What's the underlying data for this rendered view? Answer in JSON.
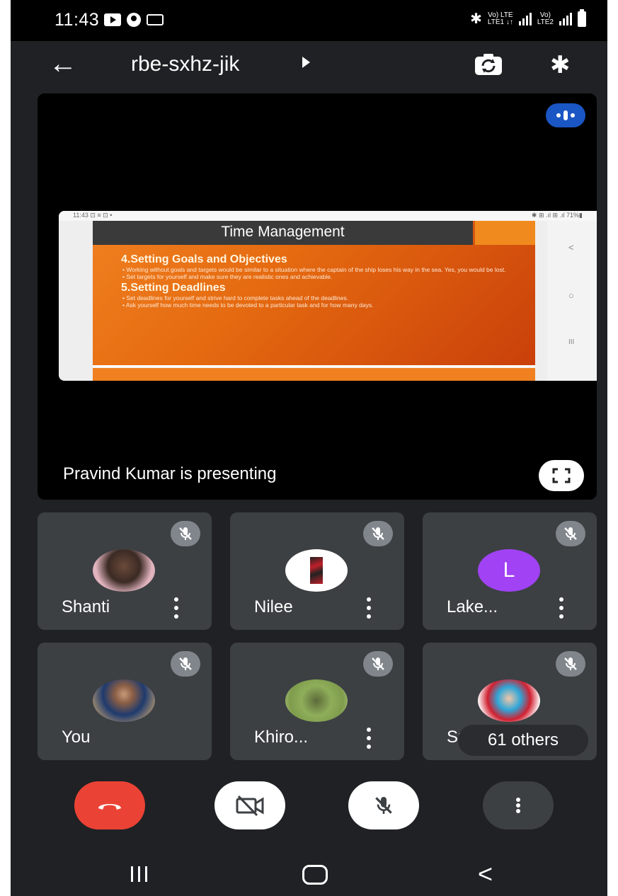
{
  "status_bar": {
    "time": "11:43",
    "network_label_1": "Vo) LTE",
    "network_sub_1": "LTE1 ↓↑",
    "network_label_2": "Vo)",
    "network_sub_2": "LTE2"
  },
  "header": {
    "meeting_code": "rbe-sxhz-jik"
  },
  "presentation": {
    "presenter_text": "Pravind Kumar is presenting",
    "slide": {
      "status_left": "11:43 ⊡ ≡ ⊡ •",
      "status_right": "✱ ⊞ .ıl ⊞ .ıl 71%▮",
      "title": "Time Management",
      "heading_1": "4.Setting Goals and Objectives",
      "bullet_1": "Working without goals and targets would be similar to a situation where the captain of the ship loses his way in the sea. Yes, you would be lost.",
      "bullet_2": "Set targets for yourself and make sure they are realistic ones and achievable.",
      "heading_2": "5.Setting Deadlines",
      "bullet_3": "Set deadlines for yourself and strive hard to complete tasks ahead of the deadlines.",
      "bullet_4": "Ask yourself how much time needs to be devoted to a particular task and for how many days.",
      "nav_back": "<",
      "nav_home": "○",
      "nav_recent": "III"
    }
  },
  "participants": [
    {
      "name": "Shanti",
      "avatar": "photo"
    },
    {
      "name": "Nilee",
      "avatar": "photo"
    },
    {
      "name": "Lake...",
      "avatar": "letter",
      "initial": "L"
    },
    {
      "name": "You",
      "avatar": "photo"
    },
    {
      "name": "Khiro...",
      "avatar": "photo"
    },
    {
      "name": "Su",
      "avatar": "photo"
    }
  ],
  "others_chip": "61 others",
  "colors": {
    "background": "#202124",
    "tile": "#3c4043",
    "end_call": "#ea4335",
    "audio_indicator": "#1a56c4",
    "letter_avatar": "#a142f4"
  },
  "icons": [
    "back-arrow-icon",
    "switch-camera-icon",
    "bluetooth-icon",
    "fullscreen-icon",
    "mic-off-icon",
    "more-vert-icon",
    "end-call-icon",
    "camera-off-icon"
  ]
}
